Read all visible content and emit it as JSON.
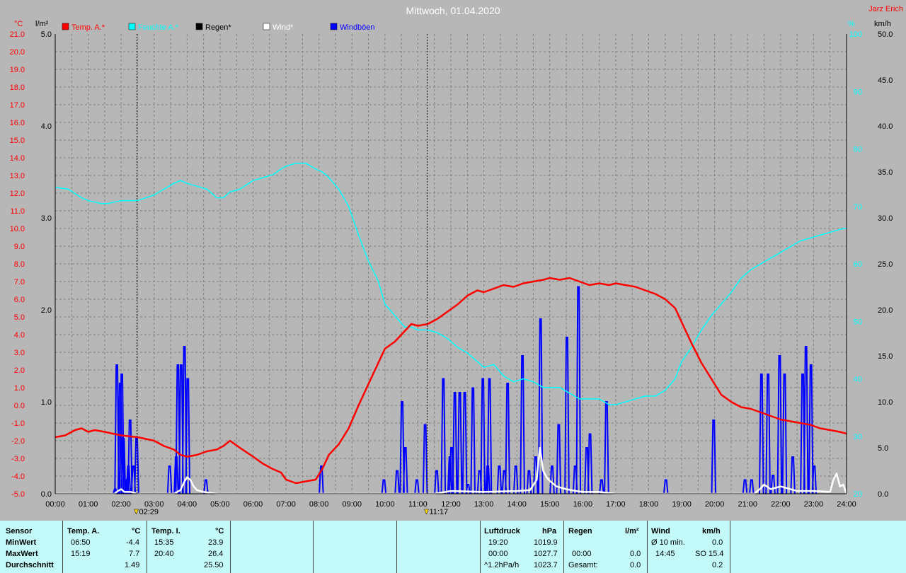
{
  "header": {
    "title": "Mittwoch, 01.04.2020",
    "author": "Jarz Erich"
  },
  "axes_labels": {
    "temp_unit": "°C",
    "rain_unit": "l/m²",
    "hum_unit": "%",
    "wind_unit": "km/h"
  },
  "legend": [
    {
      "name": "Temp. A.*",
      "color": "#ff0000"
    },
    {
      "name": "Feuchte A.*",
      "color": "#00ffff"
    },
    {
      "name": "Regen*",
      "color": "#000000"
    },
    {
      "name": "Wind*",
      "color": "#ffffff"
    },
    {
      "name": "Windböen",
      "color": "#0000ff"
    }
  ],
  "markers": [
    {
      "time": 2.48,
      "label": "02:29"
    },
    {
      "time": 11.28,
      "label": "11:17"
    }
  ],
  "chart_data": {
    "type": "line",
    "title": "Mittwoch, 01.04.2020",
    "x_ticks": [
      "00:00",
      "01:00",
      "02:00",
      "03:00",
      "04:00",
      "05:00",
      "06:00",
      "07:00",
      "08:00",
      "09:00",
      "10:00",
      "11:00",
      "12:00",
      "13:00",
      "14:00",
      "15:00",
      "16:00",
      "17:00",
      "18:00",
      "19:00",
      "20:00",
      "21:00",
      "22:00",
      "23:00",
      "24:00"
    ],
    "xlim": [
      0,
      24
    ],
    "axis_temp": {
      "unit": "°C",
      "ylim": [
        -5,
        21
      ],
      "ticks": [
        "21.0",
        "20.0",
        "19.0",
        "18.0",
        "17.0",
        "16.0",
        "15.0",
        "14.0",
        "13.0",
        "12.0",
        "11.0",
        "10.0",
        "9.0",
        "8.0",
        "7.0",
        "6.0",
        "5.0",
        "4.0",
        "3.0",
        "2.0",
        "1.0",
        "0.0",
        "-1.0",
        "-2.0",
        "-3.0",
        "-4.0",
        "-5.0"
      ]
    },
    "axis_rain": {
      "unit": "l/m²",
      "ylim": [
        0,
        5
      ],
      "ticks": [
        "5.0",
        "4.0",
        "3.0",
        "2.0",
        "1.0",
        "0.0"
      ]
    },
    "axis_hum": {
      "unit": "%",
      "ylim": [
        20,
        100
      ],
      "ticks": [
        "100",
        "90",
        "80",
        "70",
        "60",
        "50",
        "40",
        "30",
        "20"
      ]
    },
    "axis_wind": {
      "unit": "km/h",
      "ylim": [
        0,
        50
      ],
      "ticks": [
        "50.0",
        "45.0",
        "40.0",
        "35.0",
        "30.0",
        "25.0",
        "20.0",
        "15.0",
        "10.0",
        "5.0",
        "0.0"
      ]
    },
    "grid": true,
    "series": [
      {
        "name": "Temp. A.*",
        "axis": "temp",
        "color": "#ff0000",
        "x": [
          0,
          0.3,
          0.6,
          0.8,
          1.0,
          1.2,
          1.5,
          2.0,
          2.5,
          3.0,
          3.3,
          3.6,
          3.8,
          4.0,
          4.3,
          4.6,
          4.9,
          5.1,
          5.3,
          5.6,
          6.0,
          6.3,
          6.6,
          6.85,
          7.0,
          7.3,
          7.6,
          7.9,
          8.1,
          8.3,
          8.6,
          8.9,
          9.2,
          9.5,
          9.8,
          10.0,
          10.3,
          10.6,
          10.8,
          11.0,
          11.3,
          11.6,
          11.9,
          12.2,
          12.5,
          12.8,
          13.0,
          13.3,
          13.6,
          13.9,
          14.2,
          14.5,
          14.8,
          15.0,
          15.3,
          15.6,
          15.9,
          16.2,
          16.5,
          16.8,
          17.0,
          17.3,
          17.6,
          17.9,
          18.2,
          18.5,
          18.8,
          19.0,
          19.3,
          19.6,
          19.9,
          20.2,
          20.5,
          20.8,
          21.1,
          21.4,
          21.7,
          22.0,
          22.3,
          22.6,
          22.9,
          23.2,
          23.5,
          23.8,
          24.0
        ],
        "y": [
          -1.8,
          -1.7,
          -1.4,
          -1.3,
          -1.5,
          -1.4,
          -1.5,
          -1.7,
          -1.8,
          -2.0,
          -2.3,
          -2.5,
          -2.8,
          -2.9,
          -2.8,
          -2.6,
          -2.5,
          -2.3,
          -2.0,
          -2.4,
          -2.9,
          -3.3,
          -3.6,
          -3.8,
          -4.2,
          -4.4,
          -4.3,
          -4.2,
          -3.6,
          -2.8,
          -2.2,
          -1.3,
          0.0,
          1.2,
          2.4,
          3.2,
          3.6,
          4.2,
          4.6,
          4.5,
          4.6,
          4.9,
          5.3,
          5.7,
          6.2,
          6.5,
          6.4,
          6.6,
          6.8,
          6.7,
          6.9,
          7.0,
          7.1,
          7.2,
          7.1,
          7.2,
          7.0,
          6.8,
          6.9,
          6.8,
          6.9,
          6.8,
          6.7,
          6.5,
          6.3,
          6.0,
          5.5,
          4.7,
          3.5,
          2.4,
          1.5,
          0.6,
          0.2,
          -0.1,
          -0.2,
          -0.4,
          -0.6,
          -0.8,
          -0.9,
          -1.0,
          -1.1,
          -1.3,
          -1.4,
          -1.5,
          -1.6
        ]
      },
      {
        "name": "Feuchte A.*",
        "axis": "hum",
        "color": "#00ffff",
        "x": [
          0,
          0.4,
          0.8,
          1.0,
          1.4,
          1.6,
          2.0,
          2.5,
          3.0,
          3.3,
          3.6,
          3.8,
          4.0,
          4.3,
          4.6,
          4.9,
          5.1,
          5.3,
          5.6,
          6.0,
          6.3,
          6.6,
          6.85,
          7.0,
          7.3,
          7.6,
          7.9,
          8.1,
          8.3,
          8.6,
          8.9,
          9.2,
          9.5,
          9.8,
          10.0,
          10.3,
          10.6,
          10.8,
          11.0,
          11.3,
          11.6,
          11.9,
          12.2,
          12.5,
          12.8,
          13.0,
          13.3,
          13.6,
          13.9,
          14.2,
          14.5,
          14.8,
          15.0,
          15.3,
          15.6,
          15.9,
          16.2,
          16.5,
          16.8,
          17.0,
          17.3,
          17.6,
          17.9,
          18.2,
          18.5,
          18.8,
          19.0,
          19.3,
          19.6,
          19.9,
          20.2,
          20.5,
          20.8,
          21.1,
          21.4,
          21.7,
          22.0,
          22.3,
          22.6,
          22.9,
          23.2,
          23.5,
          23.8,
          24.0
        ],
        "y": [
          73.3,
          73,
          71.5,
          71,
          70.5,
          70.5,
          71,
          71,
          72,
          73,
          74,
          74.5,
          74,
          73.5,
          73,
          71.5,
          71.5,
          72.5,
          73,
          74.5,
          75,
          75.5,
          76.5,
          77,
          77.5,
          77.5,
          76.5,
          76,
          75,
          73,
          70,
          65,
          60.5,
          57,
          53,
          51,
          49,
          49,
          48.5,
          48.5,
          48,
          47,
          45.5,
          44.5,
          43,
          42,
          42.5,
          40.5,
          39.5,
          40,
          39.5,
          38.5,
          38.5,
          38.5,
          37.5,
          36.5,
          36.5,
          36.5,
          35.5,
          35.5,
          36,
          36.5,
          37,
          37,
          38,
          40,
          43,
          45.5,
          48.5,
          51,
          53,
          55,
          57.5,
          59,
          60,
          61,
          62,
          63,
          64,
          64.5,
          65,
          65.5,
          66,
          66.2
        ]
      },
      {
        "name": "Wind*",
        "axis": "wind",
        "color": "#ffffff",
        "x": [
          0,
          1.8,
          1.9,
          2.0,
          2.1,
          2.3,
          2.5,
          3.6,
          3.8,
          3.9,
          4.0,
          4.1,
          4.2,
          4.3,
          4.5,
          4.7,
          4.9,
          5.1,
          5.3,
          10.0,
          11.5,
          12.0,
          13.0,
          14.0,
          14.4,
          14.6,
          14.7,
          14.8,
          14.9,
          15.0,
          15.2,
          15.5,
          15.8,
          16.0,
          16.5,
          17.0,
          20.0,
          21.2,
          21.4,
          21.5,
          21.7,
          22.0,
          22.5,
          23.0,
          23.5,
          23.6,
          23.7,
          23.8,
          23.9,
          24.0
        ],
        "y": [
          0,
          0,
          0.3,
          0.5,
          0.2,
          0.2,
          0,
          0,
          0.4,
          1.2,
          1.8,
          1.5,
          0.8,
          0.4,
          0.2,
          0.1,
          0,
          0,
          0,
          0,
          0,
          0.3,
          0.2,
          0.3,
          0.4,
          1.5,
          5.0,
          2.5,
          1.8,
          1.4,
          0.8,
          0.5,
          0.3,
          0.2,
          0.2,
          0,
          0,
          0,
          0.6,
          1.0,
          0.5,
          0.8,
          0.3,
          0.3,
          0.2,
          1.5,
          2.2,
          0.8,
          1.0,
          0
        ]
      },
      {
        "name": "Windböen",
        "axis": "wind",
        "color": "#0000ff",
        "gusts": [
          [
            1.8,
            0.5
          ],
          [
            1.85,
            14.0
          ],
          [
            1.95,
            12.0
          ],
          [
            2.0,
            13.0
          ],
          [
            2.05,
            6.0
          ],
          [
            2.15,
            1.5
          ],
          [
            2.2,
            3.0
          ],
          [
            2.25,
            8.0
          ],
          [
            2.35,
            3.0
          ],
          [
            2.45,
            6.0
          ],
          [
            3.45,
            3.0
          ],
          [
            3.65,
            4.0
          ],
          [
            3.7,
            14.0
          ],
          [
            3.8,
            14.0
          ],
          [
            3.9,
            16.0
          ],
          [
            4.0,
            12.5
          ],
          [
            4.55,
            1.5
          ],
          [
            8.05,
            3.0
          ],
          [
            9.95,
            1.5
          ],
          [
            10.35,
            2.5
          ],
          [
            10.5,
            10.0
          ],
          [
            10.6,
            5.0
          ],
          [
            10.95,
            1.5
          ],
          [
            11.2,
            7.5
          ],
          [
            11.55,
            2.5
          ],
          [
            11.75,
            12.5
          ],
          [
            11.95,
            4.0
          ],
          [
            12.0,
            5.0
          ],
          [
            12.1,
            11.0
          ],
          [
            12.25,
            11.0
          ],
          [
            12.4,
            11.0
          ],
          [
            12.5,
            1.0
          ],
          [
            12.65,
            11.5
          ],
          [
            12.85,
            2.5
          ],
          [
            12.95,
            12.5
          ],
          [
            13.1,
            3.0
          ],
          [
            13.15,
            12.5
          ],
          [
            13.45,
            3.0
          ],
          [
            13.6,
            2.5
          ],
          [
            13.7,
            12.0
          ],
          [
            13.95,
            3.0
          ],
          [
            14.15,
            15.0
          ],
          [
            14.35,
            2.5
          ],
          [
            14.55,
            4.0
          ],
          [
            14.7,
            19.0
          ],
          [
            15.05,
            3.0
          ],
          [
            15.25,
            7.5
          ],
          [
            15.5,
            17.0
          ],
          [
            15.75,
            3.0
          ],
          [
            15.85,
            22.5
          ],
          [
            16.1,
            5.0
          ],
          [
            16.2,
            6.5
          ],
          [
            16.55,
            1.5
          ],
          [
            16.7,
            10.0
          ],
          [
            18.5,
            1.5
          ],
          [
            19.95,
            8.0
          ],
          [
            20.9,
            1.5
          ],
          [
            21.1,
            1.5
          ],
          [
            21.4,
            13.0
          ],
          [
            21.6,
            13.0
          ],
          [
            21.75,
            2.0
          ],
          [
            21.95,
            15.0
          ],
          [
            22.1,
            13.0
          ],
          [
            22.35,
            4.0
          ],
          [
            22.65,
            13.0
          ],
          [
            22.75,
            16.0
          ],
          [
            22.9,
            14.0
          ],
          [
            23.0,
            3.0
          ]
        ]
      }
    ]
  },
  "table": {
    "row_labels": [
      "Sensor",
      "MinWert",
      "MaxWert",
      "Durchschnitt"
    ],
    "temp_a": {
      "header": "Temp. A.",
      "unit": "°C",
      "min_time": "06:50",
      "min": "-4.4",
      "max_time": "15:19",
      "max": "7.7",
      "avg": "1.49"
    },
    "temp_i": {
      "header": "Temp. I.",
      "unit": "°C",
      "min_time": "15:35",
      "min": "23.9",
      "max_time": "20:40",
      "max": "26.4",
      "avg": "25.50"
    },
    "luftdruck": {
      "header": "Luftdruck",
      "unit": "hPa",
      "min_time": "19:20",
      "min": "1019.9",
      "max_time": "00:00",
      "max": "1027.7",
      "trend": "^1.2hPa/h",
      "avg": "1023.7"
    },
    "regen": {
      "header": "Regen",
      "unit": "l/m²",
      "max_time": "00:00",
      "max": "0.0",
      "total_label": "Gesamt:",
      "total": "0.0"
    },
    "wind": {
      "header": "Wind",
      "unit": "km/h",
      "avg10_label": "Ø 10 min.",
      "avg10": "0.0",
      "max_time": "14:45",
      "max": "SO 15.4",
      "avg": "0.2"
    }
  },
  "colors": {
    "background": "#b7b7b7",
    "table_bg": "#c3f9f9",
    "grid": "#7f7f7f",
    "temp": "#ff0000",
    "hum": "#00ffff",
    "wind": "#ffffff",
    "gust": "#0000ff"
  }
}
